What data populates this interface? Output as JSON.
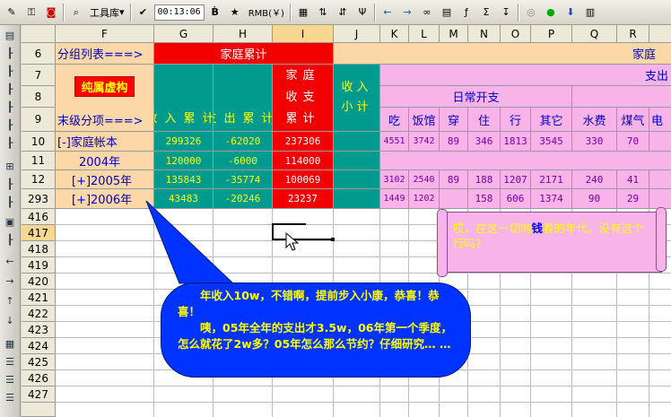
{
  "toolbar": {
    "tools_label": "工具库",
    "time": "00:13:06",
    "currency": "RMB(￥)"
  },
  "columns": [
    "F",
    "G",
    "H",
    "I",
    "J",
    "K",
    "L",
    "M",
    "N",
    "O",
    "P",
    "Q",
    "R"
  ],
  "selected_column": "I",
  "rows": {
    "r6": {
      "num": "6",
      "label": "分组列表===>",
      "family_total": "家庭累计",
      "family": "家庭"
    },
    "r7": {
      "num": "7",
      "family_income_expense": "家庭收支累计",
      "expense": "支出"
    },
    "r8": {
      "num": "8",
      "virtual": "纯属虚构",
      "income_total": "收入累计",
      "expense_total": "支出累计",
      "income_sub": "收入小计",
      "daily": "日常开支"
    },
    "r9": {
      "num": "9",
      "label": "末级分项===>",
      "cats": [
        "吃",
        "饭馆",
        "穿",
        "住",
        "行",
        "其它",
        "水费",
        "煤气",
        "电"
      ]
    },
    "r10": {
      "num": "10",
      "name": "[-]家庭帐本",
      "g": "299326",
      "h": "-62020",
      "i": "237306",
      "k": "4551",
      "l": "3742",
      "m": "89",
      "n": "346",
      "o": "1813",
      "p": "3545",
      "q": "330",
      "r": "70"
    },
    "r11": {
      "num": "11",
      "name": "2004年",
      "g": "120000",
      "h": "-6000",
      "i": "114000"
    },
    "r12": {
      "num": "12",
      "name": "[+]2005年",
      "g": "135843",
      "h": "-35774",
      "i": "100069",
      "k": "3102",
      "l": "2540",
      "m": "89",
      "n": "188",
      "o": "1207",
      "p": "2171",
      "q": "240",
      "r": "41"
    },
    "r293": {
      "num": "293",
      "name": "[+]2006年",
      "g": "43483",
      "h": "-20246",
      "i": "23237",
      "k": "1449",
      "l": "1202",
      "m": "",
      "n": "158",
      "o": "606",
      "p": "1374",
      "q": "90",
      "r": "29"
    }
  },
  "empty_rows": [
    "416",
    "417",
    "418",
    "419",
    "420",
    "421",
    "422",
    "423",
    "424",
    "425",
    "426",
    "427"
  ],
  "selected_row": "417",
  "bubble": {
    "line1": "年收入10w，不错啊，提前步入小康，恭喜！恭喜！",
    "line2": "咦，05年全年的支出才3.5w，06年第一个季度，怎么就花了2w多？05年怎么那么节约？仔细研究… …"
  },
  "scroll_note": {
    "before": "哎，在这一切向",
    "money": "钱",
    "after": "看的年代，没有这个行吗？"
  }
}
